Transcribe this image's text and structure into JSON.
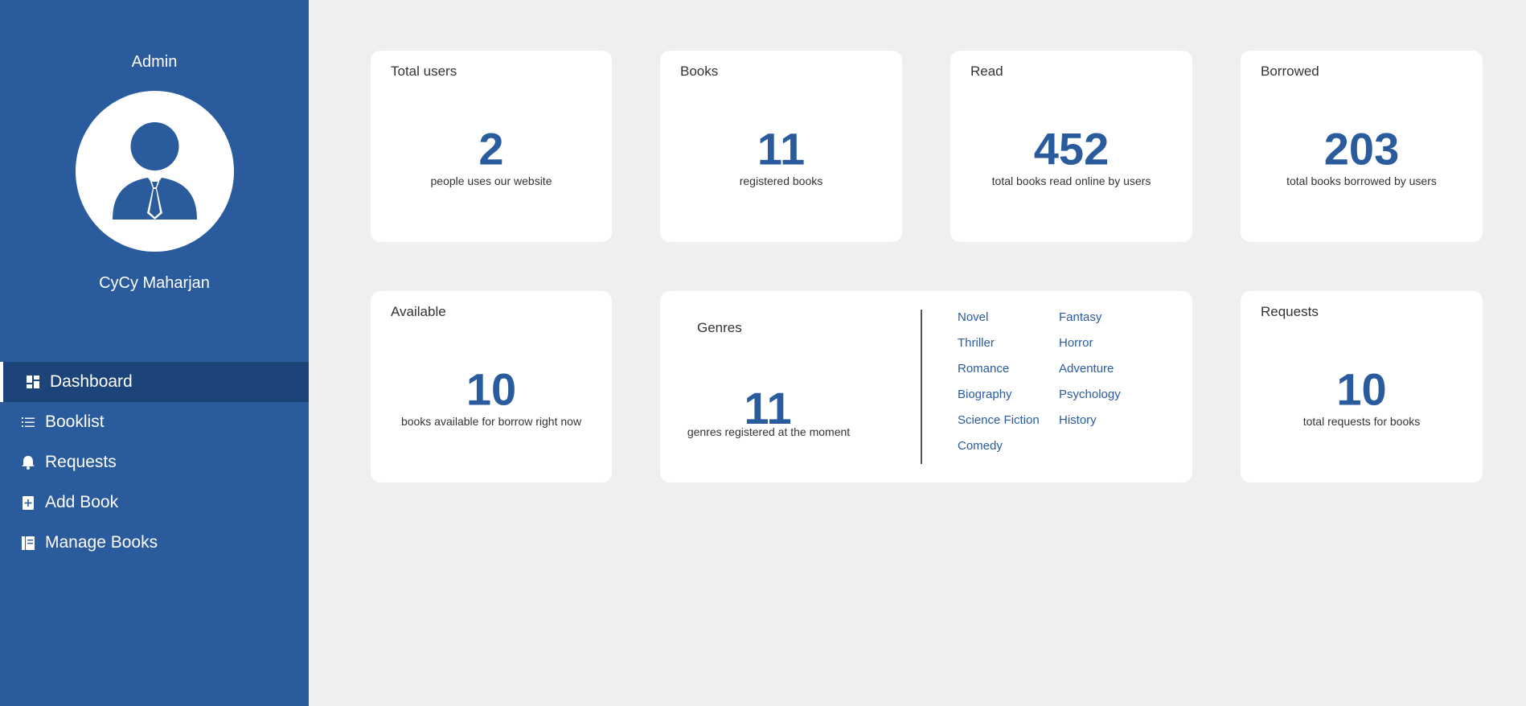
{
  "sidebar": {
    "role": "Admin",
    "username": "CyCy Maharjan",
    "nav": [
      {
        "label": "Dashboard",
        "icon": "dashboard-icon",
        "active": true
      },
      {
        "label": "Booklist",
        "icon": "list-icon"
      },
      {
        "label": "Requests",
        "icon": "bell-icon"
      },
      {
        "label": "Add Book",
        "icon": "add-book-icon"
      },
      {
        "label": "Manage Books",
        "icon": "manage-books-icon"
      }
    ]
  },
  "cards": {
    "total_users": {
      "title": "Total users",
      "value": "2",
      "desc": "people uses our website"
    },
    "books": {
      "title": "Books",
      "value": "11",
      "desc": "registered books"
    },
    "read": {
      "title": "Read",
      "value": "452",
      "desc": "total books read online by users"
    },
    "borrowed": {
      "title": "Borrowed",
      "value": "203",
      "desc": "total books borrowed by users"
    },
    "available": {
      "title": "Available",
      "value": "10",
      "desc": "books available for borrow right now"
    },
    "genres": {
      "title": "Genres",
      "value": "11",
      "desc": "genres registered at the moment",
      "list": [
        "Novel",
        "Fantasy",
        "Thriller",
        "Horror",
        "Romance",
        "Adventure",
        "Biography",
        "Psychology",
        "Science Fiction",
        "History",
        "Comedy"
      ]
    },
    "requests": {
      "title": "Requests",
      "value": "10",
      "desc": "total requests for books"
    }
  },
  "colors": {
    "accent": "#2a5b9d",
    "sidebar_active": "#1d4478",
    "background": "#efefef"
  }
}
